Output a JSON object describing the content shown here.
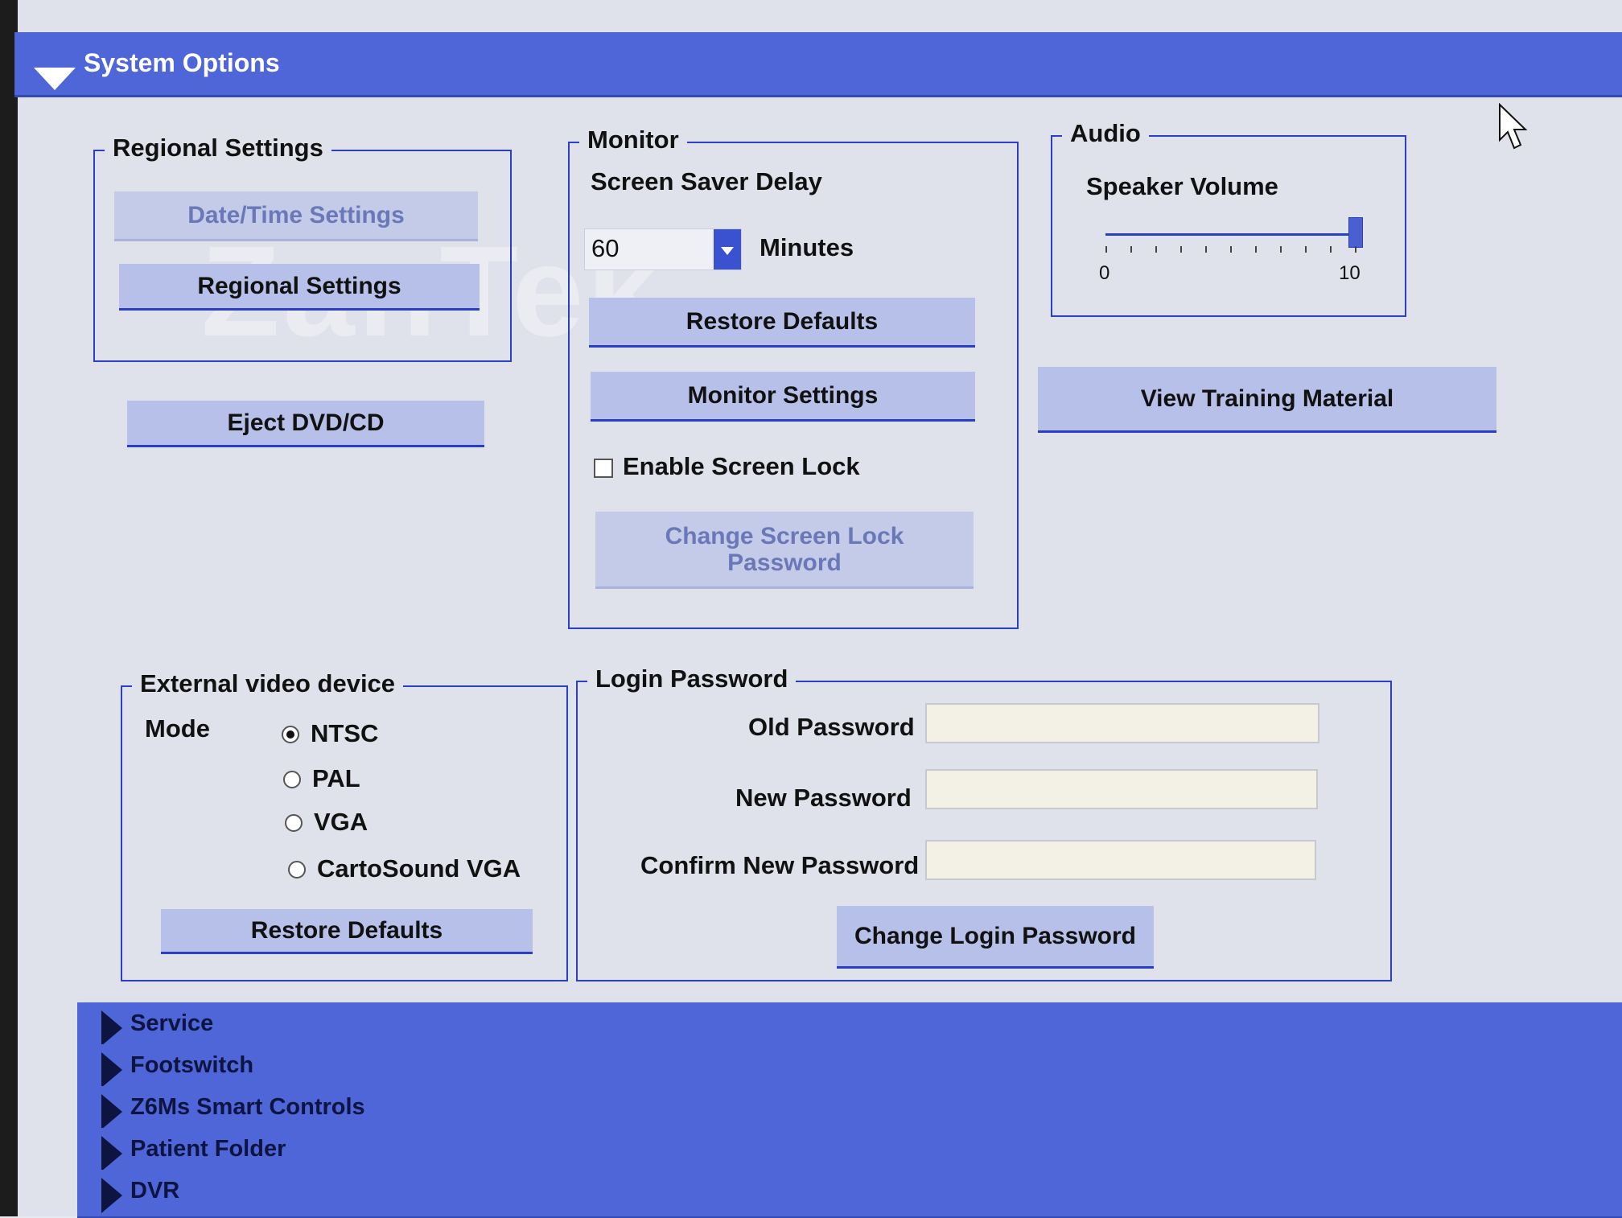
{
  "header": {
    "title": "System Options"
  },
  "regional": {
    "legend": "Regional Settings",
    "date_time_button": "Date/Time Settings",
    "regional_button": "Regional Settings"
  },
  "eject_button": "Eject DVD/CD",
  "monitor": {
    "legend": "Monitor",
    "screen_saver_label": "Screen Saver Delay",
    "screen_saver_value": "60",
    "minutes_label": "Minutes",
    "restore_defaults": "Restore Defaults",
    "monitor_settings": "Monitor Settings",
    "enable_lock_label": "Enable Screen Lock",
    "change_lock_password": "Change Screen Lock Password"
  },
  "audio": {
    "legend": "Audio",
    "speaker_volume_label": "Speaker Volume",
    "min_label": "0",
    "max_label": "10",
    "volume_value": 10
  },
  "view_training_button": "View Training Material",
  "external_video": {
    "legend": "External video device",
    "mode_label": "Mode",
    "options": [
      "NTSC",
      "PAL",
      "VGA",
      "CartoSound VGA"
    ],
    "selected": "NTSC",
    "restore_defaults": "Restore Defaults"
  },
  "login": {
    "legend": "Login Password",
    "old_label": "Old Password",
    "new_label": "New Password",
    "confirm_label": "Confirm New Password",
    "change_button": "Change Login Password"
  },
  "accordion": {
    "items": [
      "Service",
      "Footswitch",
      "Z6Ms Smart Controls",
      "Patient Folder",
      "DVR"
    ]
  },
  "watermark": "ZanTek",
  "colors": {
    "accent": "#4f66d8",
    "border": "#2a3fc4",
    "button": "#b7c0e8"
  }
}
